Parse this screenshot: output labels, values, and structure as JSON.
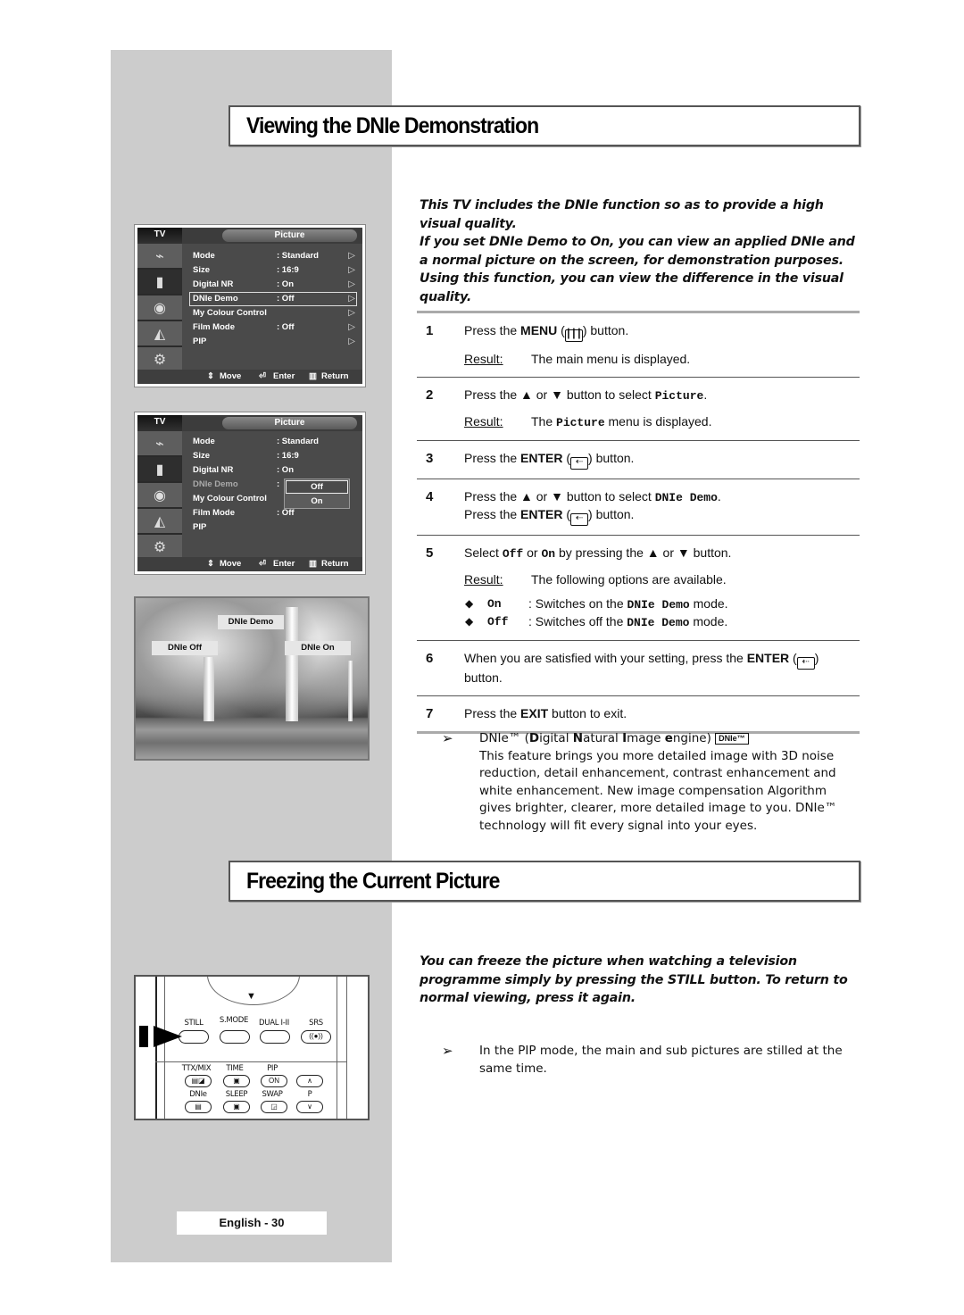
{
  "sections": {
    "dnie": {
      "title": "Viewing the DNIe Demonstration",
      "intro": "This TV includes the DNIe function so as to provide a high visual quality.\nIf you set DNIe Demo to On, you can view an applied DNIe and a normal picture on the screen, for demonstration purposes. Using this function, you can view the difference in the visual quality."
    },
    "freeze": {
      "title": "Freezing the Current Picture",
      "intro": "You can freeze the picture when watching a television programme simply by pressing the STILL button. To return to normal viewing, press it again."
    }
  },
  "osd": {
    "tv_label": "TV",
    "menu_title": "Picture",
    "side_icons": [
      "input-icon",
      "picture-icon",
      "sound-icon",
      "channel-icon",
      "setup-icon"
    ],
    "rows": [
      {
        "label": "Mode",
        "value": ": Standard"
      },
      {
        "label": "Size",
        "value": ": 16:9"
      },
      {
        "label": "Digital NR",
        "value": ": On"
      },
      {
        "label": "DNIe Demo",
        "value": ": Off"
      },
      {
        "label": "My Colour Control",
        "value": ""
      },
      {
        "label": "Film Mode",
        "value": ": Off"
      },
      {
        "label": "PIP",
        "value": ""
      }
    ],
    "arrow": "▷",
    "popup_colon": ":",
    "popup_options": [
      "Off",
      "On"
    ],
    "footer": {
      "move": "Move",
      "enter": "Enter",
      "return": "Return"
    }
  },
  "demo_image": {
    "title": "DNIe Demo",
    "left_label": "DNIe Off",
    "right_label": "DNIe On"
  },
  "steps": {
    "result_label": "Result:",
    "items": [
      {
        "num": "1",
        "pre": "Press the ",
        "bold": "MENU",
        "icon": "menu-icon",
        "post": " button.",
        "result": "The main menu is displayed."
      },
      {
        "num": "2",
        "pre": "Press the ▲ or ▼ button to select ",
        "mono": "Picture",
        "post": ".",
        "result_pre": "The ",
        "result_mono": "Picture",
        "result_post": " menu is displayed."
      },
      {
        "num": "3",
        "pre": "Press the ",
        "bold": "ENTER",
        "icon": "enter-icon",
        "post": " button."
      },
      {
        "num": "4",
        "pre": "Press the ▲ or ▼ button to select ",
        "mono": "DNIe Demo",
        "post": ".",
        "line2_pre": "Press the ",
        "line2_bold": "ENTER",
        "line2_post": " button."
      },
      {
        "num": "5",
        "pre": "Select ",
        "mono1": "Off",
        "mid": " or ",
        "mono2": "On",
        "post": " by pressing the ▲ or ▼ button.",
        "result": "The following options are available.",
        "options": [
          {
            "key": "On",
            "pre": ": Switches on the ",
            "mono": "DNIe Demo",
            "post": " mode."
          },
          {
            "key": "Off",
            "pre": ": Switches off the ",
            "mono": "DNIe Demo",
            "post": " mode."
          }
        ]
      },
      {
        "num": "6",
        "pre": "When you are satisfied with your setting, press the ",
        "bold": "ENTER",
        "post": "button."
      },
      {
        "num": "7",
        "pre": "Press the ",
        "bold": "EXIT",
        "post": " button to exit."
      }
    ]
  },
  "dnie_note": {
    "arrow": "➢",
    "heading_pre": "DNIe™ (",
    "heading_d": "D",
    "heading_igital": "igital ",
    "heading_n": "N",
    "heading_atural": "atural ",
    "heading_i": "I",
    "heading_mage": "mage ",
    "heading_e": "e",
    "heading_ngine": "ngine)",
    "badge": "DNIe™",
    "body": "This feature brings you more detailed image with 3D noise reduction, detail enhancement, contrast enhancement and white enhancement. New image compensation Algorithm gives brighter, clearer, more detailed image to you. DNIe™ technology will fit every signal into your eyes."
  },
  "pip_note": {
    "arrow": "➢",
    "body": "In the PIP mode, the main and sub pictures are stilled at the same time."
  },
  "remote": {
    "row1": [
      "STILL",
      "S.MODE",
      "DUAL I-II",
      "SRS"
    ],
    "srs_glyph": "((●))",
    "row2": [
      "TTX/MIX",
      "TIME",
      "PIP",
      ""
    ],
    "pip_btn": "ON",
    "row3": [
      "DNIe",
      "SLEEP",
      "SWAP",
      "P"
    ],
    "up_glyph": "∧",
    "down_glyph": "∨",
    "nav_down": "▼"
  },
  "footer": {
    "page": "English - 30"
  }
}
